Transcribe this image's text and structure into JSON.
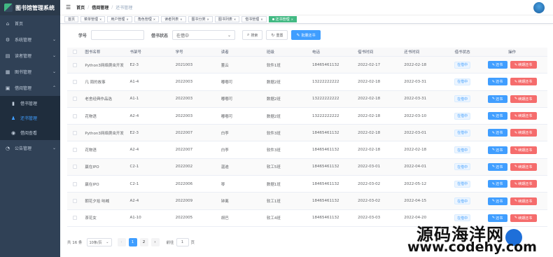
{
  "app": {
    "title": "图书馆管理系统"
  },
  "sidebar": {
    "items": [
      {
        "label": "首页",
        "icon": "home-icon"
      },
      {
        "label": "系统管理",
        "icon": "gear-icon"
      },
      {
        "label": "读者管理",
        "icon": "id-card-icon"
      },
      {
        "label": "图书管理",
        "icon": "book-icon"
      },
      {
        "label": "借阅管理",
        "icon": "borrow-icon"
      }
    ],
    "sub": [
      {
        "label": "借书管理",
        "icon": "book-icon"
      },
      {
        "label": "还书管理",
        "icon": "user-icon"
      },
      {
        "label": "借阅查看",
        "icon": "eye-icon"
      }
    ],
    "last": {
      "label": "公告管理",
      "icon": "announce-icon"
    }
  },
  "breadcrumb": {
    "home": "首页",
    "parent": "借阅管理",
    "current": "还书管理"
  },
  "tags": [
    "首页",
    "菜单管理",
    "用户管理",
    "角色管理",
    "读者列表",
    "图书分类",
    "图书列表",
    "借书管理",
    "还书管理"
  ],
  "search": {
    "student_label": "学号",
    "status_label": "借书状态",
    "status_value": "在借中",
    "search_btn": "搜索",
    "reset_btn": "重置",
    "batch_btn": "批量还书"
  },
  "table": {
    "headers": [
      "图书名称",
      "书架号",
      "学号",
      "读者",
      "班级",
      "电话",
      "借书时间",
      "还书时间",
      "借书状态",
      "操作"
    ],
    "rows": [
      {
        "name": "Python3网络爬虫开发",
        "code": "E2-3",
        "no": "2021003",
        "reader": "董云",
        "cls": "软件1班",
        "tel": "18465461132",
        "borrow": "2022-02-17",
        "ret": "2022-02-18",
        "status": "在借中"
      },
      {
        "name": "凡 周的故事",
        "code": "A1-4",
        "no": "2022003",
        "reader": "嘟嘟可",
        "cls": "数据2班",
        "tel": "13222222222",
        "borrow": "2022-02-18",
        "ret": "2022-03-31",
        "status": "在借中"
      },
      {
        "name": "老舍经典作品选",
        "code": "A1-1",
        "no": "2022003",
        "reader": "嘟嘟可",
        "cls": "数据2班",
        "tel": "13222222222",
        "borrow": "2022-02-18",
        "ret": "2022-03-31",
        "status": "在借中"
      },
      {
        "name": "花物语",
        "code": "A2-4",
        "no": "2022003",
        "reader": "嘟嘟可",
        "cls": "数据2班",
        "tel": "13222222222",
        "borrow": "2022-02-18",
        "ret": "2022-03-10",
        "status": "在借中"
      },
      {
        "name": "Python3网络爬虫开发",
        "code": "E2-3",
        "no": "2022007",
        "reader": "白李",
        "cls": "软件3班",
        "tel": "18465461132",
        "borrow": "2022-02-18",
        "ret": "2022-03-01",
        "status": "在借中"
      },
      {
        "name": "花物语",
        "code": "A2-4",
        "no": "2022007",
        "reader": "白李",
        "cls": "软件3班",
        "tel": "18465461132",
        "borrow": "2022-02-18",
        "ret": "2022-02-18",
        "status": "在借中"
      },
      {
        "name": "赢在IPO",
        "code": "C2-1",
        "no": "2022002",
        "reader": "温迪",
        "cls": "软工5班",
        "tel": "18465461132",
        "borrow": "2022-03-01",
        "ret": "2022-04-01",
        "status": "在借中"
      },
      {
        "name": "赢在IPO",
        "code": "C2-1",
        "no": "2022006",
        "reader": "琴",
        "cls": "数据1班",
        "tel": "18465461132",
        "borrow": "2022-03-02",
        "ret": "2022-05-12",
        "status": "在借中"
      },
      {
        "name": "朝花夕拾 呐喊",
        "code": "A2-4",
        "no": "2022009",
        "reader": "钟离",
        "cls": "软工1班",
        "tel": "18465461132",
        "borrow": "2022-03-02",
        "ret": "2022-04-15",
        "status": "在借中"
      },
      {
        "name": "茶花女",
        "code": "A1-10",
        "no": "2022005",
        "reader": "胡巴",
        "cls": "软工4班",
        "tel": "18465461132",
        "borrow": "2022-03-03",
        "ret": "2022-04-20",
        "status": "在借中"
      }
    ],
    "op_return": "还书",
    "op_renew": "续期还书"
  },
  "pager": {
    "total": "共 16 条",
    "size": "10条/页",
    "pages": [
      "1",
      "2"
    ],
    "goto_label": "前往",
    "goto_value": "1",
    "page_suffix": "页"
  },
  "watermark": {
    "line1": "源码海洋网",
    "line2": "www.codehy.com"
  }
}
